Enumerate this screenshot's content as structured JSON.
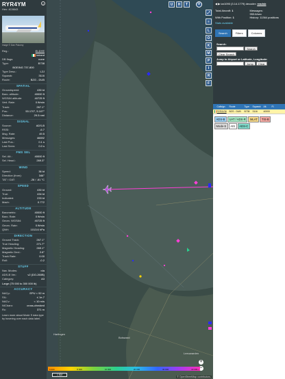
{
  "sidebar": {
    "callsign": "RYR4YM",
    "hex_line": "Hex: 4C6643",
    "close_glyph": "×",
    "photo_credit": "Image © Dan Pokorny",
    "reg": {
      "k": "Reg.:",
      "v": "EI-DYE"
    },
    "country": {
      "k": "",
      "v": "Ireland"
    },
    "db_flags": {
      "k": "DB flags:",
      "v": "none"
    },
    "type": {
      "k": "Type:",
      "v": "B738"
    },
    "model": "BOEING 737-800",
    "type_desc": {
      "k": "Type Desc.:",
      "v": "L2J"
    },
    "squawk": {
      "k": "Squawk:",
      "v": "3116"
    },
    "route": {
      "k": "Route:",
      "v": "BZG - DUB"
    },
    "sections": {
      "spatial": "SPATIAL",
      "signal": "SIGNAL",
      "fms": "FMS SEL",
      "wind": "WIND",
      "speed": "SPEED",
      "altitude": "ALTITUDE",
      "direction": "DIRECTION",
      "stuff": "STUFF",
      "accuracy": "ACCURACY"
    },
    "spatial": [
      {
        "k": "Groundspeed:",
        "v": "430 kt"
      },
      {
        "k": "Baro. altitude:",
        "v": "40000 ft"
      },
      {
        "k": "WGS84 altitude:",
        "v": "40725 ft"
      },
      {
        "k": "Vert. Rate:",
        "v": "0 ft/min"
      },
      {
        "k": "Track:",
        "v": "267.1°"
      },
      {
        "k": "Pos.:",
        "v": "53.170°, 5.107°"
      },
      {
        "k": "Distance:",
        "v": "29.5 nmi"
      }
    ],
    "signal": [
      {
        "k": "Source:",
        "v": "ADS-B"
      },
      {
        "k": "RSSI:",
        "v": "-6.7"
      },
      {
        "k": "Msg. Rate:",
        "v": "49.5"
      },
      {
        "k": "Messages:",
        "v": "46692"
      },
      {
        "k": "Last Pos.:",
        "v": "0.1 s"
      },
      {
        "k": "Last Seen:",
        "v": "0.0 s"
      }
    ],
    "fms": [
      {
        "k": "Sel. Alt.:",
        "v": "40000 ft"
      },
      {
        "k": "Sel. Head.:",
        "v": "269.3°"
      }
    ],
    "wind": [
      {
        "k": "Speed:",
        "v": "36 kt"
      },
      {
        "k": "Direction (from):",
        "v": "346°"
      },
      {
        "k": "TAT / OAT:",
        "v": "-26 / -61 °C"
      }
    ],
    "speed": [
      {
        "k": "Ground:",
        "v": "430 kt"
      },
      {
        "k": "True:",
        "v": "434 kt"
      },
      {
        "k": "Indicated:",
        "v": "233 kt"
      },
      {
        "k": "Mach:",
        "v": "0.772"
      }
    ],
    "altitude": [
      {
        "k": "Barometric:",
        "v": "40000 ft"
      },
      {
        "k": "Baro. Rate:",
        "v": "0 ft/min"
      },
      {
        "k": "Geom. WGS84:",
        "v": "40725 ft"
      },
      {
        "k": "Geom. Rate:",
        "v": "0 ft/min"
      },
      {
        "k": "QNH:",
        "v": "1013.6 hPa"
      }
    ],
    "direction": [
      {
        "k": "Ground Track:",
        "v": "267.1°"
      },
      {
        "k": "True Heading:",
        "v": "271.7°"
      },
      {
        "k": "Magnetic Heading:",
        "v": "269.1°"
      },
      {
        "k": "Magnetic Decl.:",
        "v": "2.6°"
      },
      {
        "k": "Track Rate:",
        "v": "0.00"
      },
      {
        "k": "Roll:",
        "v": "-0.2"
      }
    ],
    "stuff": [
      {
        "k": "Nav. Modes:",
        "v": "n/a"
      },
      {
        "k": "ADS-B Ver.:",
        "v": "v2 (DO-260B)"
      },
      {
        "k": "Category:",
        "v": "A3"
      }
    ],
    "stuff_extra": "Large (75 000 to 300 000 lb)",
    "accuracy": [
      {
        "k": "NACp:",
        "v": "EPU < 92 m"
      },
      {
        "k": "SIL:",
        "v": "≤ 1e-7"
      },
      {
        "k": "NACv:",
        "v": "< 10 m/s"
      },
      {
        "k": "NICbaro:",
        "v": "cross-checked"
      },
      {
        "k": "Rc:",
        "v": "371 m"
      }
    ],
    "footer": "Learn more about Mode S data type by hovering over each data label."
  },
  "map": {
    "top_buttons": [
      "U",
      "H",
      "T"
    ],
    "side_buttons": [
      "L",
      "O",
      "K",
      "M",
      "P",
      "I",
      "R",
      "F"
    ],
    "scale": "1 NM",
    "alt_ticks": [
      "6 000",
      "8 000",
      "10 000",
      "20 000",
      "30 000",
      "40 000+"
    ],
    "credit": "© OpenStreetMap contributors.",
    "town_labels": [
      "Harlingen",
      "Bolsward",
      "Leeuwarden"
    ],
    "zoom_in": "+",
    "zoom_out": "−"
  },
  "right": {
    "version_prefix": "tar1090 (3.14.1779) decoder: ",
    "version_link": "readsb",
    "stats": {
      "total_label": "Total Aircraft:",
      "total": "1",
      "messages_label": "Messages:",
      "messages": "953.6/sec",
      "with_pos_label": "With Position:",
      "with_pos": "1",
      "history_label": "History:",
      "history": "11364 positions"
    },
    "stats_link": "Stats available",
    "tabs": [
      "Search",
      "Filters",
      "Columns"
    ],
    "search_label": "Search:",
    "search_btn": "Search",
    "clear_btn": "Clear Search",
    "jump_label": "Jump to Airport or Latitude, Longitude:",
    "jump_btn": "Jump",
    "clear2_btn": "Clear",
    "columns": [
      "",
      "Callsign",
      "Route",
      "Type",
      "Squawk",
      "Alt.",
      "Fl."
    ],
    "row": [
      "",
      "RYR4YM",
      "BZG - DUB",
      "B738",
      "3116",
      "40000",
      ""
    ],
    "legend": [
      {
        "label": "ADS-B",
        "color": "#9dd0f2"
      },
      {
        "label": "UAT / ADS-R",
        "color": "#a5e7c4"
      },
      {
        "label": "MLAT",
        "color": "#f6d889"
      },
      {
        "label": "TIS-B",
        "color": "#f2a7a1"
      },
      {
        "label": "Mode-S",
        "color": "#d9d9d9"
      },
      {
        "label": "AIS",
        "color": "#ffffff"
      },
      {
        "label": "ADS-C",
        "color": "#7ed8c9"
      }
    ]
  }
}
